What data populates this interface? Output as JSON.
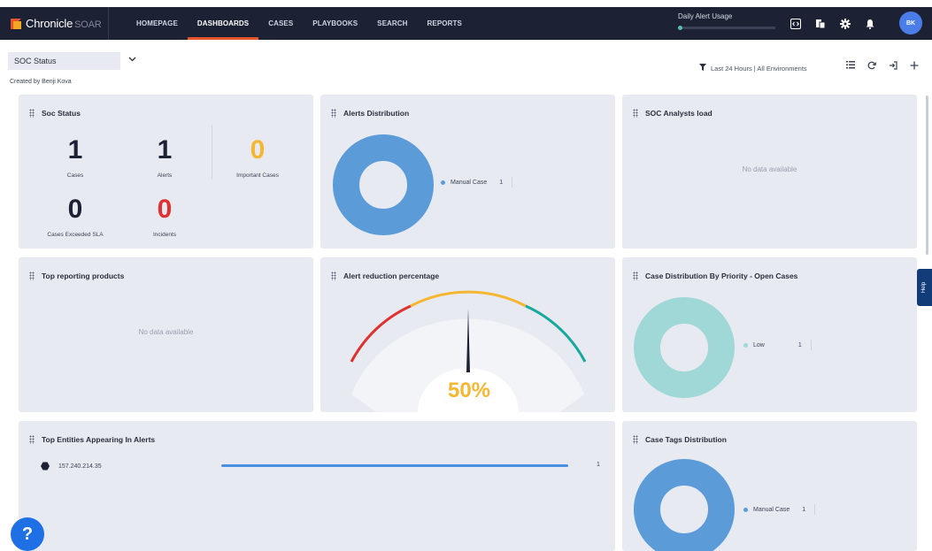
{
  "app": {
    "brand": "Chronicle",
    "brand_suffix": "SOAR"
  },
  "nav": {
    "items": [
      {
        "label": "HOMEPAGE"
      },
      {
        "label": "DASHBOARDS"
      },
      {
        "label": "CASES"
      },
      {
        "label": "PLAYBOOKS"
      },
      {
        "label": "SEARCH"
      },
      {
        "label": "REPORTS"
      }
    ],
    "active": "DASHBOARDS"
  },
  "usage": {
    "label": "Daily Alert Usage",
    "progress": 0.02
  },
  "user": {
    "initials": "BK"
  },
  "dashboard": {
    "selected": "SOC Status",
    "created_by": "Created by Benji Kova",
    "filter": "Last 24 Hours | All Environments"
  },
  "widgets": {
    "soc_status": {
      "title": "Soc Status",
      "stats": [
        {
          "value": "1",
          "label": "Cases",
          "color": "#1c2133"
        },
        {
          "value": "1",
          "label": "Alerts",
          "color": "#1c2133"
        },
        {
          "value": "0",
          "label": "Important Cases",
          "color": "#f5b731"
        },
        {
          "value": "0",
          "label": "Cases Exceeded SLA",
          "color": "#1c2133"
        },
        {
          "value": "0",
          "label": "Incidents",
          "color": "#e0302f"
        }
      ]
    },
    "alerts_distribution": {
      "title": "Alerts Distribution",
      "legend": [
        {
          "label": "Manual Case",
          "count": "1",
          "color": "#5b9bd8"
        }
      ]
    },
    "analysts_load": {
      "title": "SOC Analysts load",
      "empty": "No data available"
    },
    "top_products": {
      "title": "Top reporting products",
      "empty": "No data available"
    },
    "alert_reduction": {
      "title": "Alert reduction percentage",
      "value": "50%",
      "percent": 50
    },
    "case_priority": {
      "title": "Case Distribution By Priority - Open Cases",
      "legend": [
        {
          "label": "Low",
          "count": "1",
          "color": "#9fd8d6"
        }
      ]
    },
    "top_entities": {
      "title": "Top Entities Appearing In Alerts",
      "rows": [
        {
          "label": "157.240.214.35",
          "count": "1"
        }
      ]
    },
    "case_tags": {
      "title": "Case Tags Distribution",
      "legend": [
        {
          "label": "Manual Case",
          "count": "1",
          "color": "#5b9bd8"
        }
      ]
    }
  },
  "help": {
    "tab_label": "Help",
    "button": "?"
  }
}
